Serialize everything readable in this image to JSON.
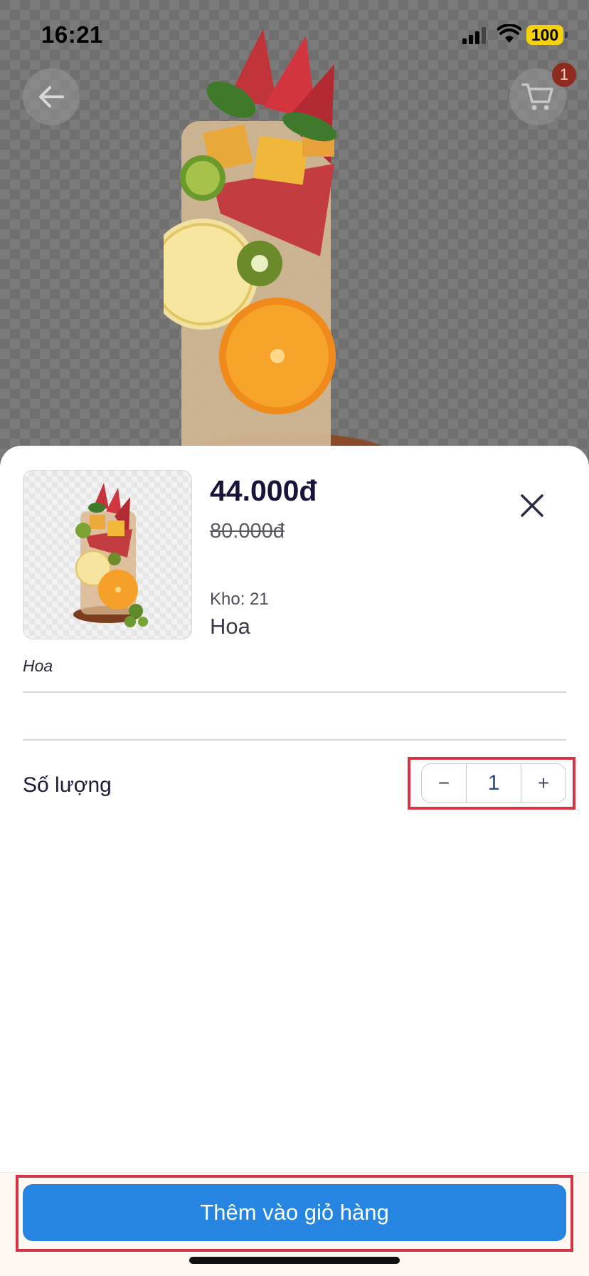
{
  "status_bar": {
    "time": "16:21",
    "battery": "100"
  },
  "header": {
    "cart_badge": "1"
  },
  "product": {
    "price": "44.000đ",
    "old_price": "80.000đ",
    "stock": "Kho: 21",
    "variant_name": "Hoa",
    "description": "Hoa"
  },
  "quantity": {
    "label": "Số lượng",
    "value": "1",
    "minus": "−",
    "plus": "+"
  },
  "footer": {
    "add_to_cart": "Thêm vào giỏ hàng"
  },
  "colors": {
    "primary_button": "#2585e1",
    "highlight_outline": "#d63445",
    "battery": "#f5d10a",
    "badge": "#8e2a1e"
  },
  "icons": {
    "back": "arrow-left-icon",
    "cart": "shopping-cart-icon",
    "close": "close-icon",
    "signal": "cellular-signal-icon",
    "wifi": "wifi-icon"
  }
}
